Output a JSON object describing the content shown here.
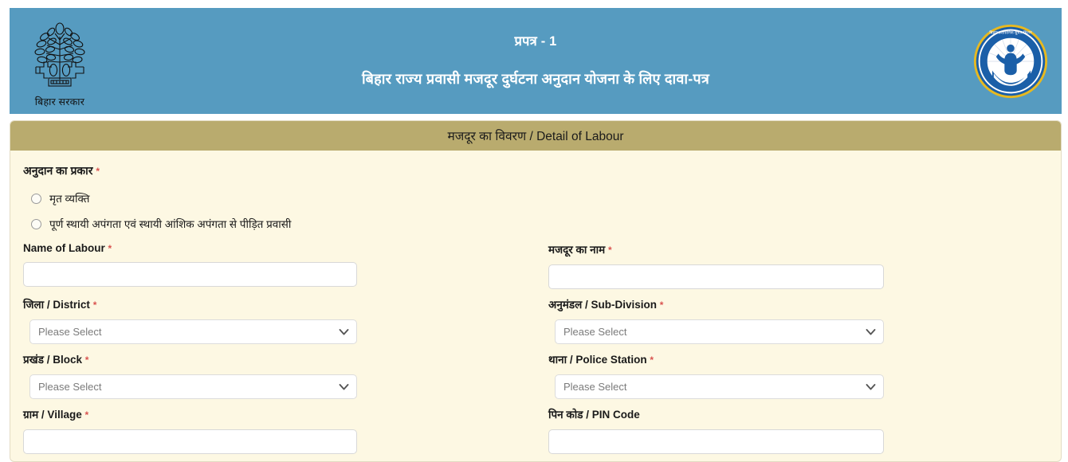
{
  "header": {
    "emblem_caption": "बिहार सरकार",
    "emblem_icon": "bihar-government-bodhi-tree-emblem",
    "title_line1": "प्रपत्र - 1",
    "title_line2": "बिहार राज्य प्रवासी मजदूर दुर्घटना अनुदान योजना के लिए दावा-पत्र",
    "mission_logo_icon": "bihar-prashasanik-sudhar-mission-logo",
    "mission_logo_text": "बिहार प्रशासनिक सुधार मिशन",
    "background_color": "#569bc0"
  },
  "section": {
    "title": "मजदूर का विवरण / Detail of Labour",
    "bar_color": "#b9ab6e",
    "panel_color": "#fdf8e3"
  },
  "form": {
    "required_marker": "*",
    "required_color": "#d9534f",
    "grant_type": {
      "label": "अनुदान का प्रकार",
      "required": true,
      "options": [
        {
          "label": "मृत व्यक्ति",
          "selected": false
        },
        {
          "label": "पूर्ण स्थायी अपंगता एवं स्थायी आंशिक अपंगता से पीड़ित प्रवासी",
          "selected": false
        }
      ]
    },
    "fields": [
      {
        "id": "name-of-labour",
        "label": "Name of Labour",
        "required": true,
        "type": "text",
        "value": "",
        "placeholder": ""
      },
      {
        "id": "majdoor-ka-naam",
        "label": "मजदूर का नाम",
        "required": true,
        "type": "text",
        "value": "",
        "placeholder": ""
      },
      {
        "id": "district",
        "label": "जिला / District",
        "required": true,
        "type": "select",
        "value": "Please Select"
      },
      {
        "id": "sub-division",
        "label": "अनुमंडल / Sub-Division",
        "required": true,
        "type": "select",
        "value": "Please Select"
      },
      {
        "id": "block",
        "label": "प्रखंड / Block",
        "required": true,
        "type": "select",
        "value": "Please Select"
      },
      {
        "id": "police-station",
        "label": "थाना / Police Station",
        "required": true,
        "type": "select",
        "value": "Please Select"
      },
      {
        "id": "village",
        "label": "ग्राम / Village",
        "required": true,
        "type": "text",
        "value": "",
        "placeholder": ""
      },
      {
        "id": "pin-code",
        "label": "पिन कोड / PIN Code",
        "required": false,
        "type": "text",
        "value": "",
        "placeholder": ""
      }
    ]
  }
}
